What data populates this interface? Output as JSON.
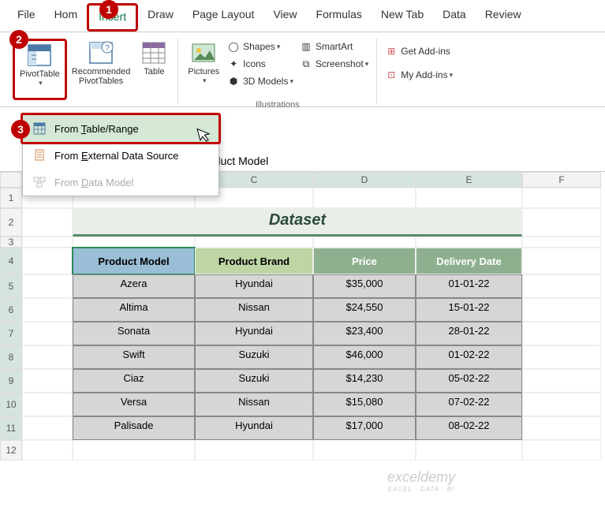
{
  "menu": {
    "file": "File",
    "home": "Hom",
    "insert": "Insert",
    "draw": "Draw",
    "page_layout": "Page Layout",
    "view": "View",
    "formulas": "Formulas",
    "new_tab": "New Tab",
    "data": "Data",
    "review": "Review"
  },
  "ribbon": {
    "pivot_table": "PivotTable",
    "recommended_pivot": "Recommended\nPivotTables",
    "table": "Table",
    "pictures": "Pictures",
    "shapes": "Shapes",
    "icons": "Icons",
    "models_3d": "3D Models",
    "illustrations_label": "Illustrations",
    "smartart": "SmartArt",
    "screenshot": "Screenshot",
    "get_addins": "Get Add-ins",
    "my_addins": "My Add-ins"
  },
  "dropdown": {
    "from_table": "From Table/Range",
    "from_external": "From External Data Source",
    "from_model": "From Data Model"
  },
  "formula": {
    "cell_value": "Product Model"
  },
  "cols": {
    "c": "C",
    "d": "D",
    "e": "E",
    "f": "F"
  },
  "rows": {
    "r1": "1",
    "r2": "2",
    "r3": "3",
    "r4": "4",
    "r5": "5",
    "r6": "6",
    "r7": "7",
    "r8": "8",
    "r9": "9",
    "r10": "10",
    "r11": "11",
    "r12": "12"
  },
  "dataset_title": "Dataset",
  "headers": {
    "model": "Product Model",
    "brand": "Product Brand",
    "price": "Price",
    "date": "Delivery Date"
  },
  "data": [
    {
      "model": "Azera",
      "brand": "Hyundai",
      "price": "$35,000",
      "date": "01-01-22"
    },
    {
      "model": "Altima",
      "brand": "Nissan",
      "price": "$24,550",
      "date": "15-01-22"
    },
    {
      "model": "Sonata",
      "brand": "Hyundai",
      "price": "$23,400",
      "date": "28-01-22"
    },
    {
      "model": "Swift",
      "brand": "Suzuki",
      "price": "$46,000",
      "date": "01-02-22"
    },
    {
      "model": "Ciaz",
      "brand": "Suzuki",
      "price": "$14,230",
      "date": "05-02-22"
    },
    {
      "model": "Versa",
      "brand": "Nissan",
      "price": "$15,080",
      "date": "07-02-22"
    },
    {
      "model": "Palisade",
      "brand": "Hyundai",
      "price": "$17,000",
      "date": "08-02-22"
    }
  ],
  "badges": {
    "b1": "1",
    "b2": "2",
    "b3": "3"
  },
  "watermark": {
    "main": "exceldemy",
    "sub": "EXCEL · DATA · BI"
  }
}
